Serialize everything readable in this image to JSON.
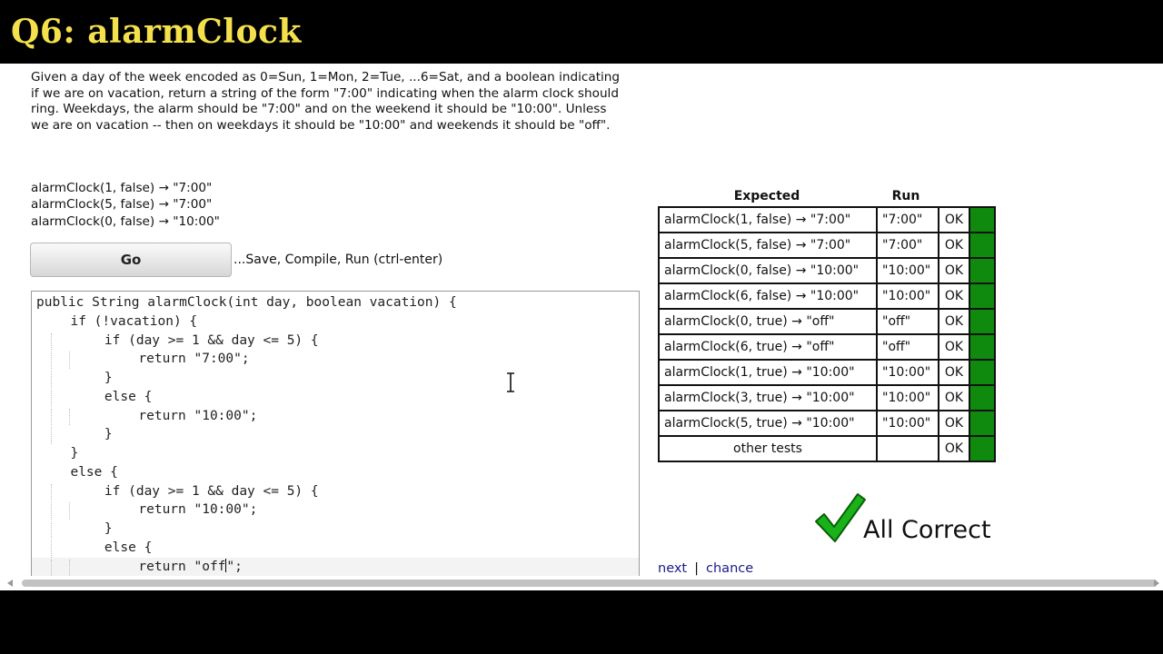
{
  "title": "Q6: alarmClock",
  "description": "Given a day of the week encoded as 0=Sun, 1=Mon, 2=Tue, ...6=Sat, and a boolean indicating if we are on vacation, return a string of the form \"7:00\" indicating when the alarm clock should ring. Weekdays, the alarm should be \"7:00\" and on the weekend it should be \"10:00\". Unless we are on vacation -- then on weekdays it should be \"10:00\" and weekends it should be \"off\".",
  "examples": [
    "alarmClock(1, false) → \"7:00\"",
    "alarmClock(5, false) → \"7:00\"",
    "alarmClock(0, false) → \"10:00\""
  ],
  "go": {
    "label": "Go",
    "hint": "...Save, Compile, Run (ctrl-enter)"
  },
  "code": {
    "lines": [
      "public String alarmClock(int day, boolean vacation) {",
      "  if (!vacation) {",
      "    if (day >= 1 && day <= 5) {",
      "      return \"7:00\";",
      "    }",
      "    else {",
      "      return \"10:00\";",
      "    }",
      "  }",
      "  else {",
      "    if (day >= 1 && day <= 5) {",
      "      return \"10:00\";",
      "    }",
      "    else {",
      "      return \"off\";"
    ],
    "active_line": 14
  },
  "results": {
    "headers": {
      "expected": "Expected",
      "run": "Run"
    },
    "rows": [
      {
        "expected": "alarmClock(1, false) → \"7:00\"",
        "run": "\"7:00\"",
        "status": "OK"
      },
      {
        "expected": "alarmClock(5, false) → \"7:00\"",
        "run": "\"7:00\"",
        "status": "OK"
      },
      {
        "expected": "alarmClock(0, false) → \"10:00\"",
        "run": "\"10:00\"",
        "status": "OK"
      },
      {
        "expected": "alarmClock(6, false) → \"10:00\"",
        "run": "\"10:00\"",
        "status": "OK"
      },
      {
        "expected": "alarmClock(0, true) → \"off\"",
        "run": "\"off\"",
        "status": "OK"
      },
      {
        "expected": "alarmClock(6, true) → \"off\"",
        "run": "\"off\"",
        "status": "OK"
      },
      {
        "expected": "alarmClock(1, true) → \"10:00\"",
        "run": "\"10:00\"",
        "status": "OK"
      },
      {
        "expected": "alarmClock(3, true) → \"10:00\"",
        "run": "\"10:00\"",
        "status": "OK"
      },
      {
        "expected": "alarmClock(5, true) → \"10:00\"",
        "run": "\"10:00\"",
        "status": "OK"
      }
    ],
    "other": {
      "label": "other tests",
      "run": "",
      "status": "OK"
    },
    "pass_color": "#0f8a0f"
  },
  "verdict": {
    "text": "All Correct",
    "icon": "checkmark-icon",
    "color": "#19b319"
  },
  "nav": {
    "next": "next",
    "separator": "|",
    "chance": "chance"
  }
}
